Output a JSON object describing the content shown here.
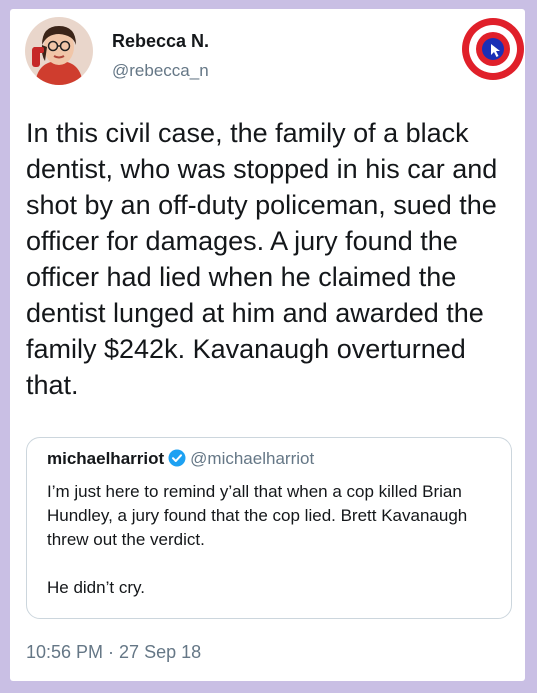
{
  "author": {
    "name": "Rebecca N.",
    "handle": "@rebecca_n",
    "avatar_icon": "woman-on-phone-avatar"
  },
  "badge_icon": "shield-target-badge-icon",
  "tweet_text": "In this civil case, the family of a black dentist, who was stopped in his car and shot by an off-duty policeman, sued the officer for damages. A jury found the officer had lied when he claimed the dentist lunged at him and awarded the family $242k. Kavanaugh overturned that.",
  "quoted_tweet": {
    "name": "michaelharriot",
    "verified_icon": "verified-check-icon",
    "handle": "@michaelharriot",
    "paragraph1": "I’m just here to remind y’all that when a cop killed Brian Hundley, a jury found that the cop lied. Brett Kavanaugh threw out the verdict.",
    "paragraph2": "He didn’t cry."
  },
  "timestamp": "10:56 PM · 27 Sep 18",
  "colors": {
    "background": "#c9bfe4",
    "text": "#14171a",
    "secondary_text": "#657786",
    "verified_blue": "#1da1f2",
    "badge_red": "#e0202a",
    "badge_blue": "#1b2fb5"
  }
}
